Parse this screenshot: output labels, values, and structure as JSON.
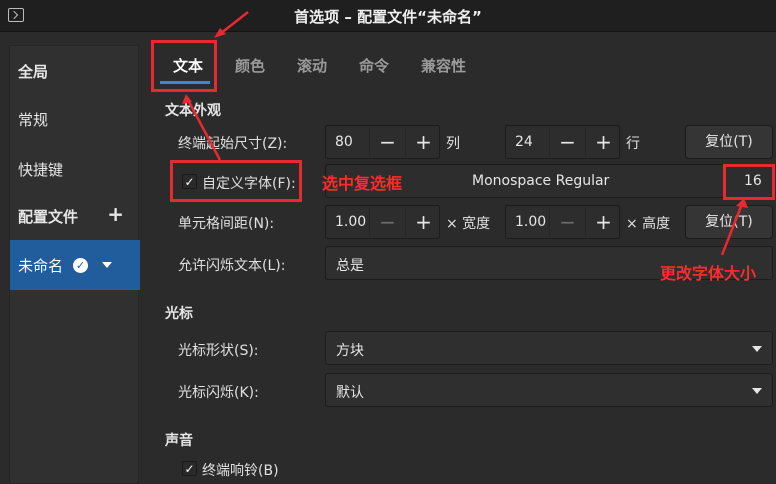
{
  "window": {
    "title": "首选项 – 配置文件“未命名”"
  },
  "sidebar": {
    "general": "全局",
    "normal": "常规",
    "shortcuts": "快捷键",
    "profiles": "配置文件",
    "add_symbol": "+",
    "profile_name": "未命名",
    "check_symbol": "✓"
  },
  "tabs": [
    "文本",
    "颜色",
    "滚动",
    "命令",
    "兼容性"
  ],
  "text_appearance": {
    "heading": "文本外观",
    "initial_size_label": "终端起始尺寸(Z):",
    "cols_value": "80",
    "cols_unit": "列",
    "rows_value": "24",
    "rows_unit": "行",
    "reset_label": "复位(T)",
    "custom_font_label": "自定义字体(F):",
    "font_name": "Monospace Regular",
    "font_size": "16",
    "cell_spacing_label": "单元格间距(N):",
    "width_value": "1.00",
    "width_unit": "× 宽度",
    "height_value": "1.00",
    "height_unit": "× 高度",
    "reset2_label": "复位(T)",
    "blink_label": "允许闪烁文本(L):",
    "blink_value": "总是"
  },
  "cursor": {
    "heading": "光标",
    "shape_label": "光标形状(S):",
    "shape_value": "方块",
    "blink_label": "光标闪烁(K):",
    "blink_value": "默认"
  },
  "sound": {
    "heading": "声音",
    "bell_label": "终端响铃(B)"
  },
  "symbols": {
    "minus": "−",
    "plus": "+",
    "check": "✓"
  },
  "annotations": {
    "checkbox_note": "选中复选框",
    "font_size_note": "更改字体大小"
  },
  "colors": {
    "accent": "#215d9c",
    "annotation": "#e8292f"
  }
}
